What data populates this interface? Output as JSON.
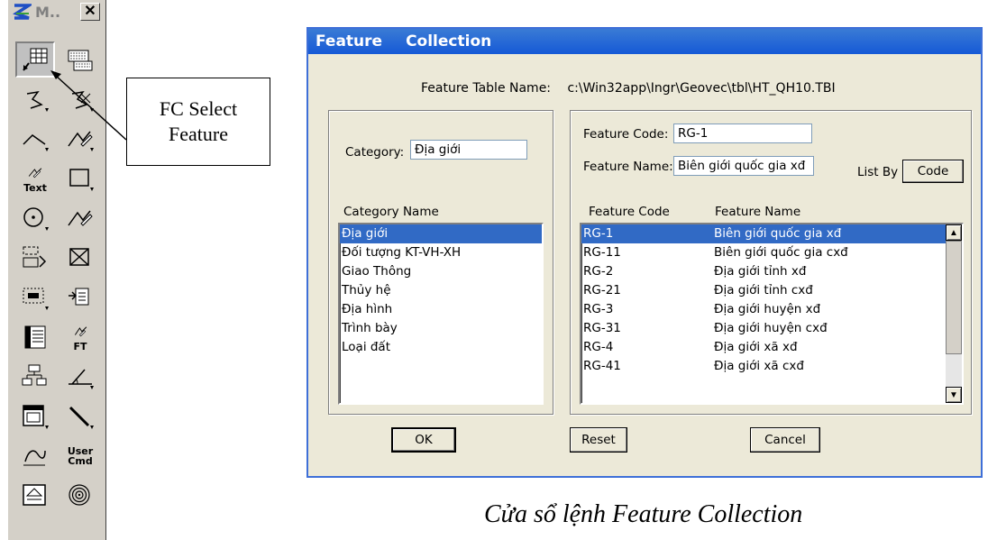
{
  "palette": {
    "title": "M..",
    "close_glyph": "✕",
    "tools": [
      {
        "icon": "select-feature-icon"
      },
      {
        "icon": "keyboard-feature-icon"
      },
      {
        "icon": "place-linestring-icon"
      },
      {
        "icon": "delete-linestring-icon"
      },
      {
        "icon": "place-line-icon"
      },
      {
        "icon": "edit-line-icon"
      },
      {
        "icon": "place-text-icon",
        "label": "Text"
      },
      {
        "icon": "place-rectangle-icon"
      },
      {
        "icon": "place-circle-icon"
      },
      {
        "icon": "modify-element-icon"
      },
      {
        "icon": "copy-element-icon"
      },
      {
        "icon": "delete-element-icon"
      },
      {
        "icon": "fence-icon"
      },
      {
        "icon": "import-icon"
      },
      {
        "icon": "attribute-table-icon"
      },
      {
        "icon": "feature-table-icon",
        "label": "FT"
      },
      {
        "icon": "tree-icon"
      },
      {
        "icon": "angle-icon"
      },
      {
        "icon": "window-icon"
      },
      {
        "icon": "diagonal-line-icon"
      },
      {
        "icon": "curve-icon"
      },
      {
        "icon": "user-command-icon",
        "label": "User\nCmd"
      },
      {
        "icon": "bottom-tool-icon"
      },
      {
        "icon": "spiral-icon"
      }
    ]
  },
  "callout": {
    "line1": "FC Select",
    "line2": "Feature"
  },
  "dialog": {
    "title_left": "Feature",
    "title_right": "Collection",
    "feature_table_label": "Feature Table Name:",
    "feature_table_value": "c:\\Win32app\\Ingr\\Geovec\\tbl\\HT_QH10.TBI",
    "category_label": "Category:",
    "category_value": "Địa giới",
    "category_list_header": "Category Name",
    "categories": [
      "Địa giới",
      "Đối tượng KT-VH-XH",
      "Giao Thông",
      "Thủy hệ",
      "Địa hình",
      "Trình bày",
      "Loại đất"
    ],
    "feature_code_label": "Feature  Code:",
    "feature_code_value": "RG-1",
    "feature_name_label": "Feature Name:",
    "feature_name_value": "Biên giới quốc gia xđ",
    "list_by_label": "List By",
    "list_by_button": "Code",
    "fc_header_code": "Feature Code",
    "fc_header_name": "Feature Name",
    "features": [
      {
        "code": "RG-1",
        "name": "Biên giới quốc gia xđ"
      },
      {
        "code": "RG-11",
        "name": "Biên giới quốc gia cxđ"
      },
      {
        "code": "RG-2",
        "name": "Địa giới tỉnh xđ"
      },
      {
        "code": "RG-21",
        "name": "Địa giới tỉnh cxđ"
      },
      {
        "code": "RG-3",
        "name": "Địa giới huyện xđ"
      },
      {
        "code": "RG-31",
        "name": "Địa giới huyện cxđ"
      },
      {
        "code": "RG-4",
        "name": "Địa giới xã xđ"
      },
      {
        "code": "RG-41",
        "name": "Địa giới xã cxđ"
      }
    ],
    "ok_button": "OK",
    "reset_button": "Reset",
    "cancel_button": "Cancel"
  },
  "caption": "Cửa sổ lệnh Feature Collection"
}
